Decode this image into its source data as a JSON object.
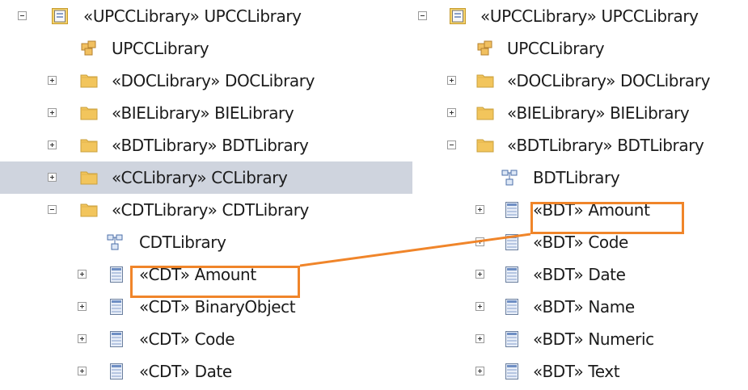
{
  "left_tree": {
    "root": {
      "label": "«UPCCLibrary» UPCCLibrary",
      "expander": "minus",
      "icon": "library-icon"
    },
    "diagram": {
      "label": "UPCCLibrary",
      "icon": "package-diagram-icon"
    },
    "doc": {
      "label": "«DOCLibrary» DOCLibrary",
      "expander": "plus",
      "icon": "folder-icon"
    },
    "bie": {
      "label": "«BIELibrary» BIELibrary",
      "expander": "plus",
      "icon": "folder-icon"
    },
    "bdt": {
      "label": "«BDTLibrary» BDTLibrary",
      "expander": "plus",
      "icon": "folder-icon"
    },
    "cc": {
      "label": "«CCLibrary» CCLibrary",
      "expander": "plus",
      "icon": "folder-icon",
      "selected": true
    },
    "cdt": {
      "label": "«CDTLibrary» CDTLibrary",
      "expander": "minus",
      "icon": "folder-icon"
    },
    "cdt_diagram": {
      "label": "CDTLibrary",
      "icon": "class-diagram-icon"
    },
    "items": [
      {
        "label": "«CDT» Amount",
        "icon": "class-icon",
        "highlighted": true
      },
      {
        "label": "«CDT» BinaryObject",
        "icon": "class-icon"
      },
      {
        "label": "«CDT» Code",
        "icon": "class-icon"
      },
      {
        "label": "«CDT» Date",
        "icon": "class-icon"
      }
    ]
  },
  "right_tree": {
    "root": {
      "label": "«UPCCLibrary» UPCCLibrary",
      "expander": "minus",
      "icon": "library-icon"
    },
    "diagram": {
      "label": "UPCCLibrary",
      "icon": "package-diagram-icon"
    },
    "doc": {
      "label": "«DOCLibrary» DOCLibrary",
      "expander": "plus",
      "icon": "folder-icon"
    },
    "bie": {
      "label": "«BIELibrary» BIELibrary",
      "expander": "plus",
      "icon": "folder-icon"
    },
    "bdt": {
      "label": "«BDTLibrary» BDTLibrary",
      "expander": "minus",
      "icon": "folder-icon"
    },
    "bdt_diagram": {
      "label": "BDTLibrary",
      "icon": "class-diagram-icon"
    },
    "items": [
      {
        "label": "«BDT» Amount",
        "icon": "class-icon",
        "highlighted": true
      },
      {
        "label": "«BDT» Code",
        "icon": "class-icon"
      },
      {
        "label": "«BDT» Date",
        "icon": "class-icon"
      },
      {
        "label": "«BDT» Name",
        "icon": "class-icon"
      },
      {
        "label": "«BDT» Numeric",
        "icon": "class-icon"
      },
      {
        "label": "«BDT» Text",
        "icon": "class-icon"
      }
    ]
  },
  "colors": {
    "highlight": "#f0852a",
    "selection": "#cfd4de",
    "folder": "#f2c55c"
  }
}
